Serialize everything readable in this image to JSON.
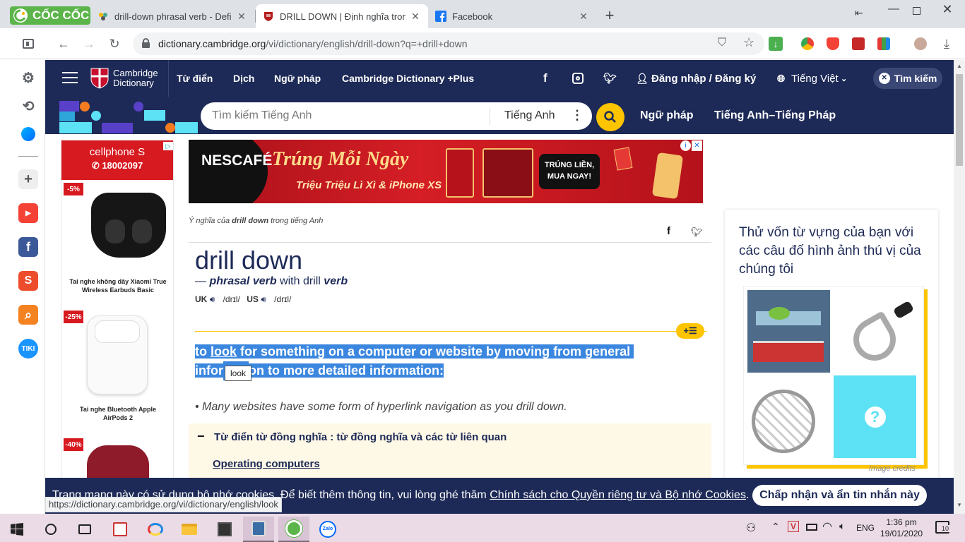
{
  "browser": {
    "brand": "CỐC CỐC",
    "tabs": [
      {
        "title": "drill-down phrasal verb - Definitio"
      },
      {
        "title": "DRILL DOWN | Định nghĩa trong Ti"
      },
      {
        "title": "Facebook"
      }
    ],
    "new_tab": "+",
    "url_domain": "dictionary.cambridge.org",
    "url_path": "/vi/dictionary/english/drill-down?q=+drill+down",
    "status_url": "https://dictionary.cambridge.org/vi/dictionary/english/look"
  },
  "site": {
    "logo_line1": "Cambridge",
    "logo_line2": "Dictionary",
    "nav": [
      "Từ điển",
      "Dịch",
      "Ngữ pháp",
      "Cambridge Dictionary +Plus"
    ],
    "login": "Đăng nhập / Đăng ký",
    "language": "Tiếng Việt",
    "search_button": "Tìm kiếm",
    "search_placeholder": "Tìm kiếm Tiếng Anh",
    "search_dict": "Tiếng Anh",
    "nav2": [
      "Ngữ pháp",
      "Tiếng Anh–Tiếng Pháp"
    ]
  },
  "ads": {
    "left_brand": "cellphone S",
    "left_phone": "18002097",
    "products": [
      {
        "discount": "-5%",
        "name": "Tai nghe không dây Xiaomi True Wireless Earbuds Basic"
      },
      {
        "discount": "-25%",
        "name": "Tai nghe Bluetooth Apple AirPods 2"
      },
      {
        "discount": "-40%",
        "name": ""
      }
    ],
    "top_brand": "NESCAFÉ",
    "top_headline": "Trúng Mỗi Ngày",
    "top_sub": "Triệu Triệu Lì Xì & iPhone XS",
    "top_cta": "TRÚNG LIỀN, MUA NGAY!"
  },
  "entry": {
    "breadcrumb_pre": "Ý nghĩa của ",
    "breadcrumb_word": "drill down",
    "breadcrumb_post": " trong tiếng Anh",
    "headword": "drill down",
    "pos_prefix": "— ",
    "pos": "phrasal verb",
    "with_text": " with drill ",
    "with_pos": "verb",
    "uk_label": "UK",
    "uk_ipa": "/drɪl/",
    "us_label": "US",
    "us_ipa": "/drɪl/",
    "def_line1_a": "to ",
    "def_line1_link": "look",
    "def_line1_b": " for something on a computer or website by moving from general",
    "def_line2_a": "infor",
    "def_line2_b": "on to more detailed information:",
    "tooltip": "look",
    "example": "Many websites have some form of hyperlink navigation as you drill down.",
    "thesaurus_title": "Từ điển từ đồng nghĩa : từ đồng nghĩa và các từ liên quan",
    "thesaurus_link": "Operating computers"
  },
  "quiz": {
    "title": "Thử vốn từ vựng của bạn với các câu đố hình ảnh thú vị của chúng tôi",
    "question_mark": "?",
    "credits": "Image credits"
  },
  "cookie": {
    "text": "Trang mạng này có sử dụng bộ nhớ cookies. Để biết thêm thông tin, vui lòng ghé thăm ",
    "link": "Chính sách cho Quyền riêng tư và Bộ nhớ Cookies",
    "end": ".",
    "button": "Chấp nhận và ẩn tin nhắn này"
  },
  "taskbar": {
    "lang": "ENG",
    "time": "1:36 pm",
    "date": "19/01/2020",
    "notifications": "10",
    "zalo": "Zalo"
  },
  "colors": {
    "cambridge_navy": "#1d2a57",
    "cambridge_yellow": "#fec400",
    "selection_blue": "#3b87e0",
    "coccoc_green": "#5bb54a"
  }
}
